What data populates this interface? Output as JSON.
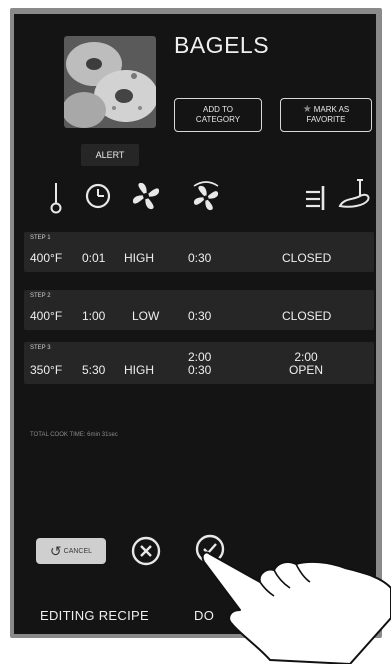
{
  "recipe": {
    "title": "BAGELS",
    "alert_label": "ALERT",
    "add_to_category": [
      "ADD TO",
      "CATEGORY"
    ],
    "mark_as_favorite": [
      "MARK AS",
      "FAVORITE"
    ]
  },
  "icons": [
    "thermometer-icon",
    "timer-icon",
    "fan-icon",
    "fan-speed-icon",
    "vent-damper-icon",
    "conveyor-paddle-icon"
  ],
  "steps": [
    {
      "label": "STEP 1",
      "temp": "400°F",
      "time": "0:01",
      "fan": "HIGH",
      "fan_time": [
        "0:30"
      ],
      "vent": [
        "CLOSED"
      ]
    },
    {
      "label": "STEP 2",
      "temp": "400°F",
      "time": "1:00",
      "fan": "LOW",
      "fan_time": [
        "0:30"
      ],
      "vent": [
        "CLOSED"
      ]
    },
    {
      "label": "STEP 3",
      "temp": "350°F",
      "time": "5:30",
      "fan": "HIGH",
      "fan_time": [
        "2:00",
        "0:30"
      ],
      "vent": [
        "2:00",
        "OPEN"
      ]
    }
  ],
  "total_cook_time": "TOTAL COOK TIME: 6min 31sec",
  "actions": {
    "cancel_label": "CANCEL"
  },
  "footer": {
    "editing_label": "EDITING RECIPE",
    "done_label": "DO"
  },
  "colors": {
    "screen_bg": "#141414",
    "row_bg": "#262626",
    "text": "#efefef",
    "bezel": "#8a8a8a"
  }
}
